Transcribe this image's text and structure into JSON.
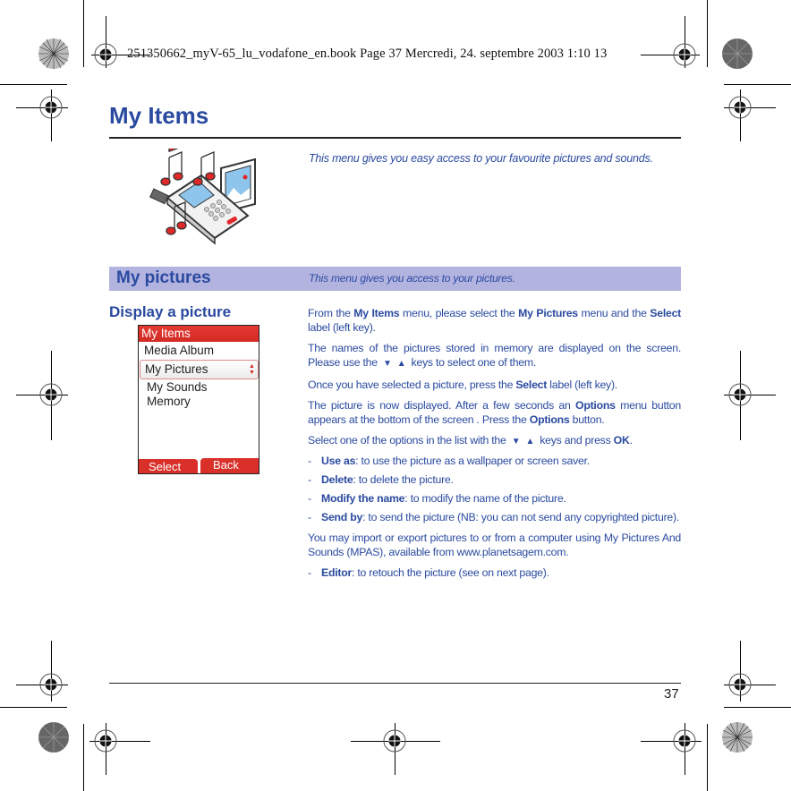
{
  "print_header": "251350662_myV-65_lu_vodafone_en.book  Page 37  Mercredi, 24. septembre 2003  1:10 13",
  "page": {
    "title": "My Items",
    "intro": "This menu gives you easy access to your favourite pictures and sounds.",
    "illustration_icon": "phone-with-music-notes-and-picture-icon",
    "page_number": "37"
  },
  "section": {
    "title": "My pictures",
    "description": "This menu gives you access to your pictures."
  },
  "subsection": {
    "title": "Display a picture"
  },
  "phone_screen": {
    "title": "My Items",
    "items": [
      "Media Album",
      "My Pictures",
      "My Sounds",
      "Memory"
    ],
    "selected_index": 1,
    "left_softkey": "Select",
    "right_softkey": "Back"
  },
  "body": {
    "p1": {
      "t1": "From the ",
      "b1": "My Items",
      "t2": " menu, please select the ",
      "b2": "My Pictures",
      "t3": " menu and the ",
      "b3": "Select",
      "t4": " label (left key)."
    },
    "p2": {
      "t1": "The names of the pictures stored in memory are displayed on the screen. Please use the",
      "down": "▼",
      "up": "▲",
      "t2": "keys to select one of them."
    },
    "p3": {
      "t1": "Once you have selected a picture, press the ",
      "b1": "Select",
      "t2": " label (left key)."
    },
    "p4": {
      "t1": "The picture is now displayed. After a few seconds an ",
      "b1": "Options",
      "t2": " menu button appears at the bottom of the screen . Press the ",
      "b2": "Options",
      "t3": " button."
    },
    "p5": {
      "t1": "Select one of the options in the list with the",
      "down": "▼",
      "up": "▲",
      "t2": "keys and press ",
      "b1": "OK",
      "t3": "."
    },
    "options": [
      {
        "label": "Use as",
        "desc": ": to use the picture as a wallpaper or screen saver."
      },
      {
        "label": "Delete",
        "desc": ": to delete the picture."
      },
      {
        "label": "Modify the name",
        "desc": ": to modify the name of the picture."
      },
      {
        "label": "Send by",
        "desc": ": to send the picture (NB: you can not send any copyrighted picture)."
      }
    ],
    "p6": "You may import or export pictures to or from a computer using My Pictures And Sounds (MPAS), available from www.planetsagem.com.",
    "editor": {
      "label": "Editor",
      "desc": ": to retouch the picture (see on next page)."
    }
  },
  "colors": {
    "text_blue": "#2a4aa0",
    "band_lavender": "#b3b3e0",
    "phone_red": "#d9302a"
  }
}
